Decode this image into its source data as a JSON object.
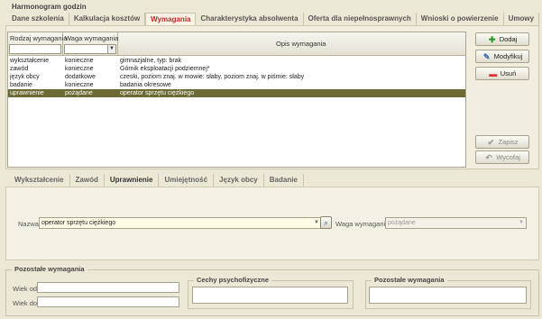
{
  "top_tabs": {
    "parent": "Harmonogram godzin",
    "items": [
      {
        "label": "Dane szkolenia",
        "active": false
      },
      {
        "label": "Kalkulacja kosztów",
        "active": false
      },
      {
        "label": "Wymagania",
        "active": true
      },
      {
        "label": "Charakterystyka absolwenta",
        "active": false
      },
      {
        "label": "Oferta dla niepełnosprawnych",
        "active": false
      },
      {
        "label": "Wnioski o powierzenie",
        "active": false
      },
      {
        "label": "Umowy",
        "active": false
      }
    ]
  },
  "grid": {
    "columns": [
      "Rodzaj wymagania",
      "Waga wymagania",
      "Opis wymagania"
    ],
    "rows": [
      {
        "rodzaj": "wykształcenie",
        "waga": "konieczne",
        "opis": "gimnazjalne, typ: brak",
        "selected": false
      },
      {
        "rodzaj": "zawód",
        "waga": "konieczne",
        "opis": "Górnik eksploatacji podziemnej*",
        "selected": false
      },
      {
        "rodzaj": "język obcy",
        "waga": "dodatkowe",
        "opis": "czeski, poziom znaj. w mowie: słaby, poziom znaj. w piśmie: słaby",
        "selected": false
      },
      {
        "rodzaj": "badanie",
        "waga": "konieczne",
        "opis": "badania okresowe",
        "selected": false
      },
      {
        "rodzaj": "uprawnienie",
        "waga": "pożądane",
        "opis": "operator sprzętu ciężkiego",
        "selected": true
      }
    ]
  },
  "buttons": {
    "add": "Dodaj",
    "modify": "Modyfikuj",
    "delete": "Usuń",
    "save": "Zapisz",
    "revert": "Wycofaj"
  },
  "sub_tabs": {
    "items": [
      {
        "label": "Wykształcenie",
        "active": false
      },
      {
        "label": "Zawód",
        "active": false
      },
      {
        "label": "Uprawnienie",
        "active": true
      },
      {
        "label": "Umiejętność",
        "active": false
      },
      {
        "label": "Język obcy",
        "active": false
      },
      {
        "label": "Badanie",
        "active": false
      }
    ]
  },
  "form": {
    "name_label": "Nazwa:",
    "name_value": "operator sprzętu ciężkiego",
    "weight_label": "Waga wymagania:",
    "weight_value": "pożądane"
  },
  "bottom": {
    "pozostale_title": "Pozostałe wymagania",
    "wiek_od_label": "Wiek od:",
    "wiek_do_label": "Wiek do:",
    "wiek_od_value": "",
    "wiek_do_value": "",
    "cechy_title": "Cechy psychofizyczne",
    "cechy_value": "",
    "pozostale2_title": "Pozostałe wymagania",
    "pozostale2_value": ""
  }
}
